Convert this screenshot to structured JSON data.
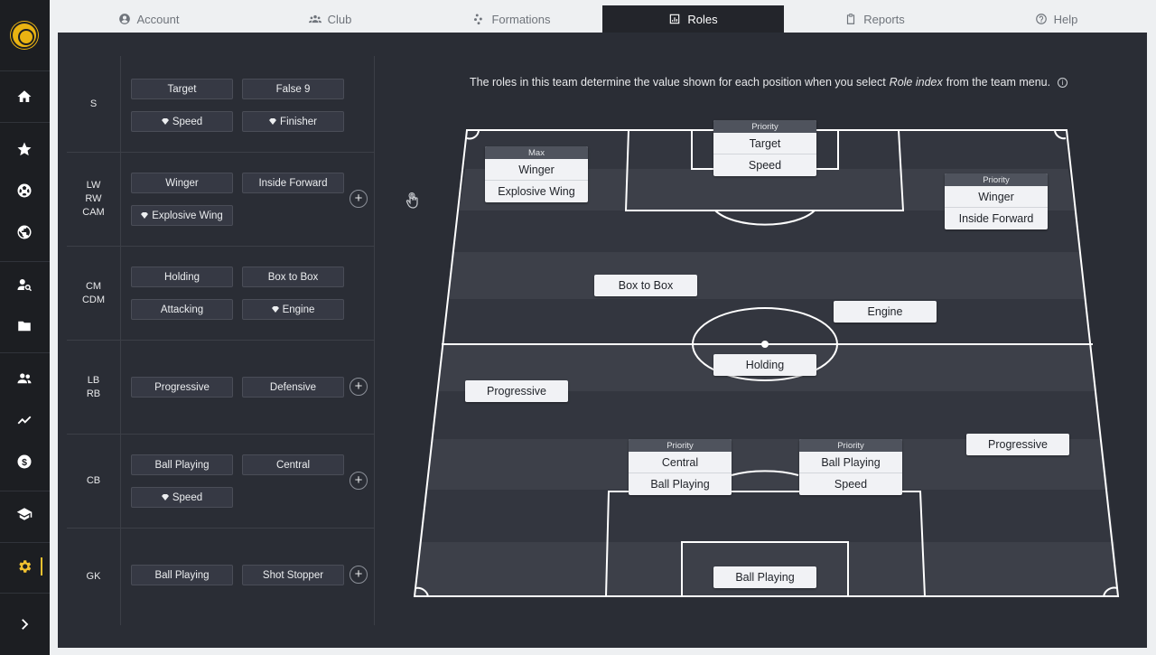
{
  "sidebar": {
    "logo": "club-crest",
    "items": [
      {
        "name": "home-icon"
      },
      {
        "name": "star-icon"
      },
      {
        "name": "football-icon"
      },
      {
        "name": "globe-icon"
      },
      {
        "name": "scout-icon"
      },
      {
        "name": "folder-icon"
      },
      {
        "name": "people-icon"
      },
      {
        "name": "trend-icon"
      },
      {
        "name": "dollar-icon"
      },
      {
        "name": "graduation-cap-icon"
      },
      {
        "name": "settings-icon"
      },
      {
        "name": "expand-icon"
      }
    ]
  },
  "tabs": [
    {
      "label": "Account",
      "icon": "user-circle-icon"
    },
    {
      "label": "Club",
      "icon": "users-icon"
    },
    {
      "label": "Formations",
      "icon": "formation-icon"
    },
    {
      "label": "Roles",
      "icon": "chart-icon",
      "active": true
    },
    {
      "label": "Reports",
      "icon": "clipboard-icon"
    },
    {
      "label": "Help",
      "icon": "question-icon"
    }
  ],
  "info": {
    "prefix": "The roles in this team determine the value shown for each position when you select",
    "emphasis": "Role index",
    "suffix": "from the team menu."
  },
  "groups": [
    {
      "label": "S",
      "chips": [
        {
          "text": "Target",
          "gem": false
        },
        {
          "text": "False 9",
          "gem": false
        },
        {
          "text": "Speed",
          "gem": true
        },
        {
          "text": "Finisher",
          "gem": true
        }
      ]
    },
    {
      "label": "LW\nRW\nCAM",
      "chips": [
        {
          "text": "Winger",
          "gem": false
        },
        {
          "text": "Inside Forward",
          "gem": false
        },
        {
          "text": "Explosive Wing",
          "gem": true
        }
      ]
    },
    {
      "label": "CM\nCDM",
      "chips": [
        {
          "text": "Holding",
          "gem": false
        },
        {
          "text": "Box to Box",
          "gem": false
        },
        {
          "text": "Attacking",
          "gem": false
        },
        {
          "text": "Engine",
          "gem": true
        }
      ]
    },
    {
      "label": "LB\nRB",
      "chips": [
        {
          "text": "Progressive",
          "gem": false
        },
        {
          "text": "Defensive",
          "gem": false
        }
      ]
    },
    {
      "label": "CB",
      "chips": [
        {
          "text": "Ball Playing",
          "gem": false
        },
        {
          "text": "Central",
          "gem": false
        },
        {
          "text": "Speed",
          "gem": true
        }
      ]
    },
    {
      "label": "GK",
      "chips": [
        {
          "text": "Ball Playing",
          "gem": false
        },
        {
          "text": "Shot Stopper",
          "gem": false
        }
      ]
    }
  ],
  "plus_label": "+",
  "pitch_cards": [
    {
      "id": "lw",
      "header": "Max",
      "rows": [
        "Winger",
        "Explosive Wing"
      ]
    },
    {
      "id": "st",
      "header": "Priority",
      "rows": [
        "Target",
        "Speed"
      ]
    },
    {
      "id": "rw",
      "header": "Priority",
      "rows": [
        "Winger",
        "Inside Forward"
      ]
    },
    {
      "id": "lcm",
      "header": null,
      "rows": [
        "Box to Box"
      ]
    },
    {
      "id": "rcm",
      "header": null,
      "rows": [
        "Engine"
      ]
    },
    {
      "id": "cdm",
      "header": null,
      "rows": [
        "Holding"
      ]
    },
    {
      "id": "lb",
      "header": null,
      "rows": [
        "Progressive"
      ]
    },
    {
      "id": "rb",
      "header": null,
      "rows": [
        "Progressive"
      ]
    },
    {
      "id": "lcb",
      "header": "Priority",
      "rows": [
        "Central",
        "Ball Playing"
      ]
    },
    {
      "id": "rcb",
      "header": "Priority",
      "rows": [
        "Ball Playing",
        "Speed"
      ]
    },
    {
      "id": "gk",
      "header": null,
      "rows": [
        "Ball Playing"
      ]
    }
  ],
  "colors": {
    "accent": "#f2c230",
    "panel": "#2a2d35",
    "sidebar": "#1c1e22",
    "pitch_stripe_light": "#3f434c",
    "pitch_stripe_dark": "#33363f"
  }
}
